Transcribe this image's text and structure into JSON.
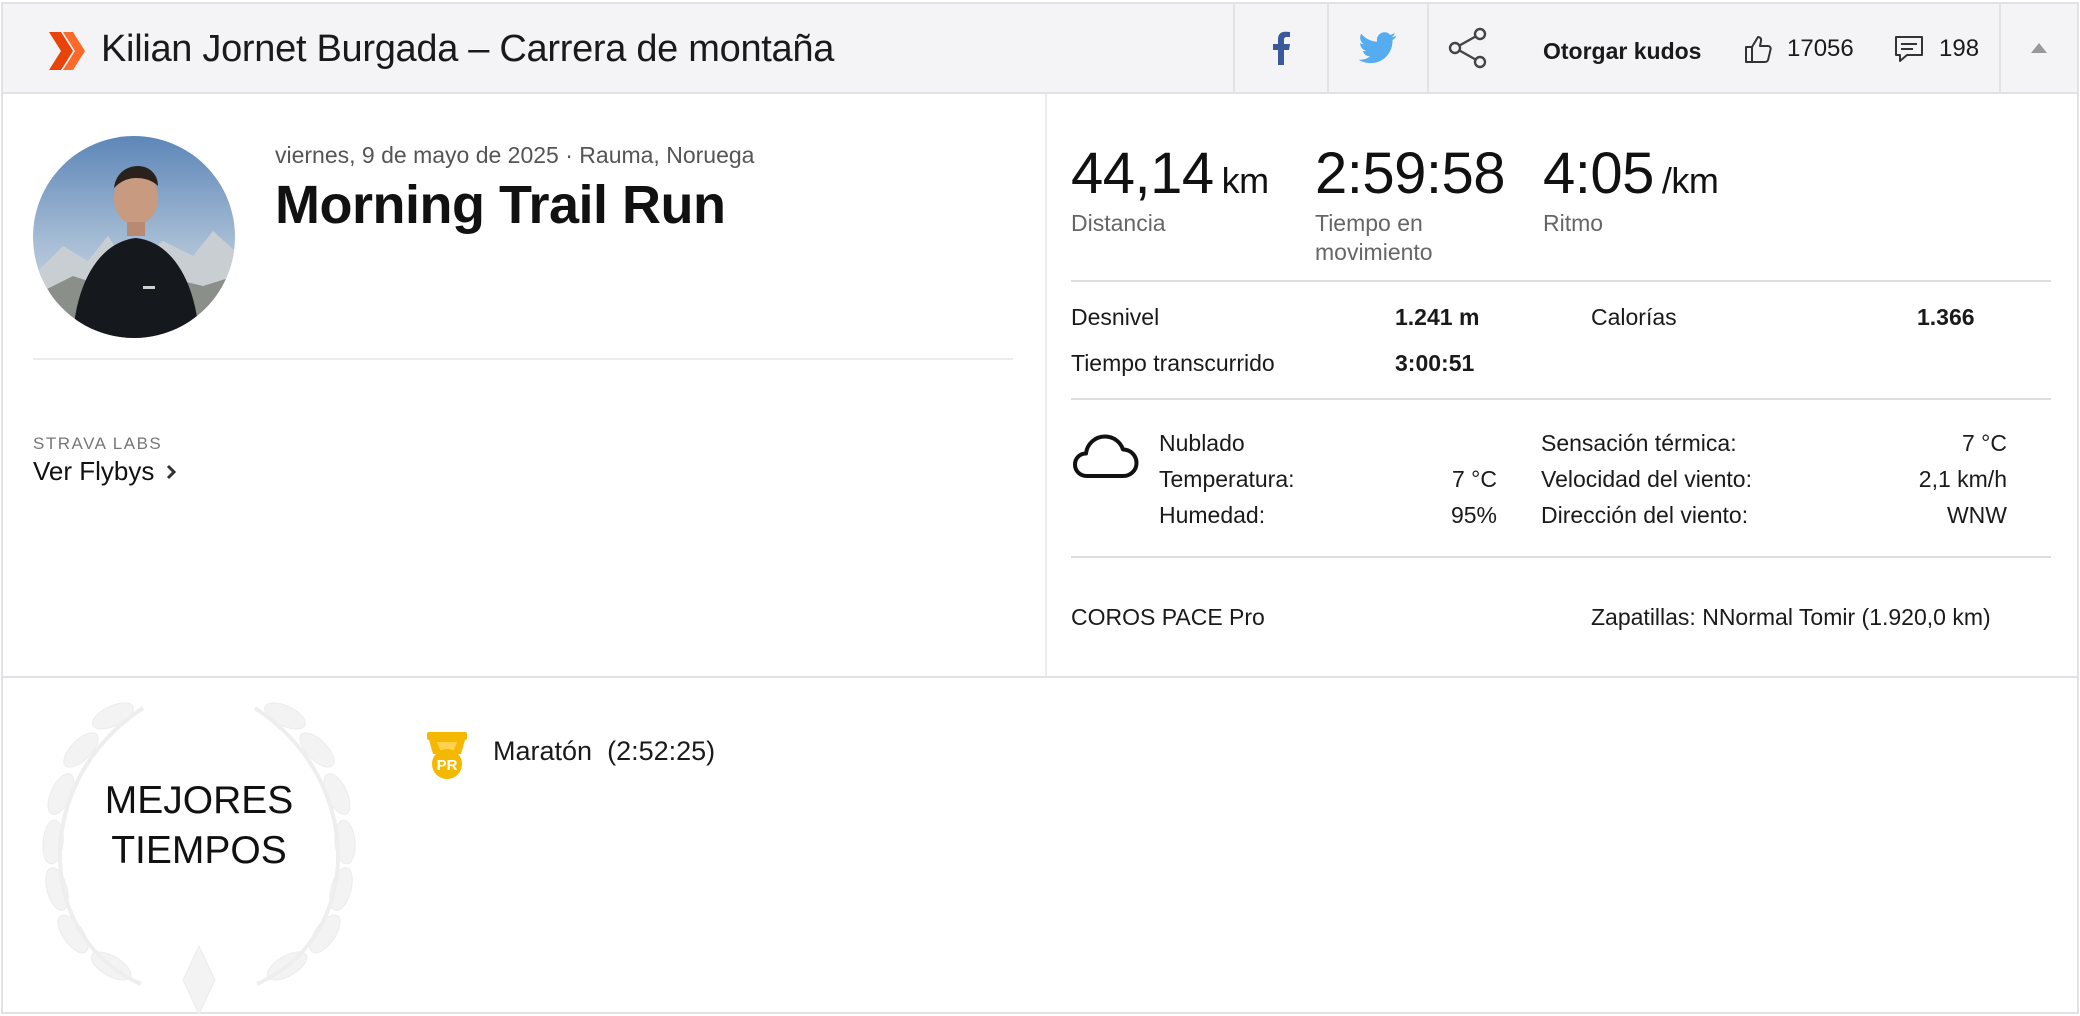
{
  "header": {
    "title": "Kilian Jornet Burgada – Carrera de montaña",
    "give_kudos_label": "Otorgar kudos",
    "kudos_count": "17056",
    "comment_count": "198",
    "brand_color": "#fc4c02"
  },
  "activity": {
    "meta": "viernes, 9 de mayo de 2025 · Rauma, Noruega",
    "name": "Morning Trail Run",
    "labs_label": "STRAVA LABS",
    "flyby_label": "Ver Flybys"
  },
  "stats": {
    "distance": {
      "value": "44,14",
      "unit": "km",
      "label": "Distancia"
    },
    "moving_time": {
      "value": "2:59:58",
      "label_line1": "Tiempo en",
      "label_line2": "movimiento"
    },
    "pace": {
      "value": "4:05",
      "unit": "/km",
      "label": "Ritmo"
    }
  },
  "details": {
    "elevation_label": "Desnivel",
    "elevation_value": "1.241 m",
    "calories_label": "Calorías",
    "calories_value": "1.366",
    "elapsed_label": "Tiempo transcurrido",
    "elapsed_value": "3:00:51"
  },
  "weather": {
    "icon": "cloud-icon",
    "condition": "Nublado",
    "temperature_label": "Temperatura:",
    "temperature_value": "7 °C",
    "humidity_label": "Humedad:",
    "humidity_value": "95%",
    "feels_like_label": "Sensación térmica:",
    "feels_like_value": "7 °C",
    "wind_speed_label": "Velocidad del viento:",
    "wind_speed_value": "2,1 km/h",
    "wind_dir_label": "Dirección del viento:",
    "wind_dir_value": "WNW"
  },
  "gear": {
    "device": "COROS PACE Pro",
    "shoes": "Zapatillas: NNormal Tomir (1.920,0 km)"
  },
  "best_efforts": {
    "title_line1": "MEJORES",
    "title_line2": "TIEMPOS",
    "badge": "PR",
    "items": [
      {
        "label": "Maratón",
        "time": "(2:52:25)"
      }
    ]
  }
}
